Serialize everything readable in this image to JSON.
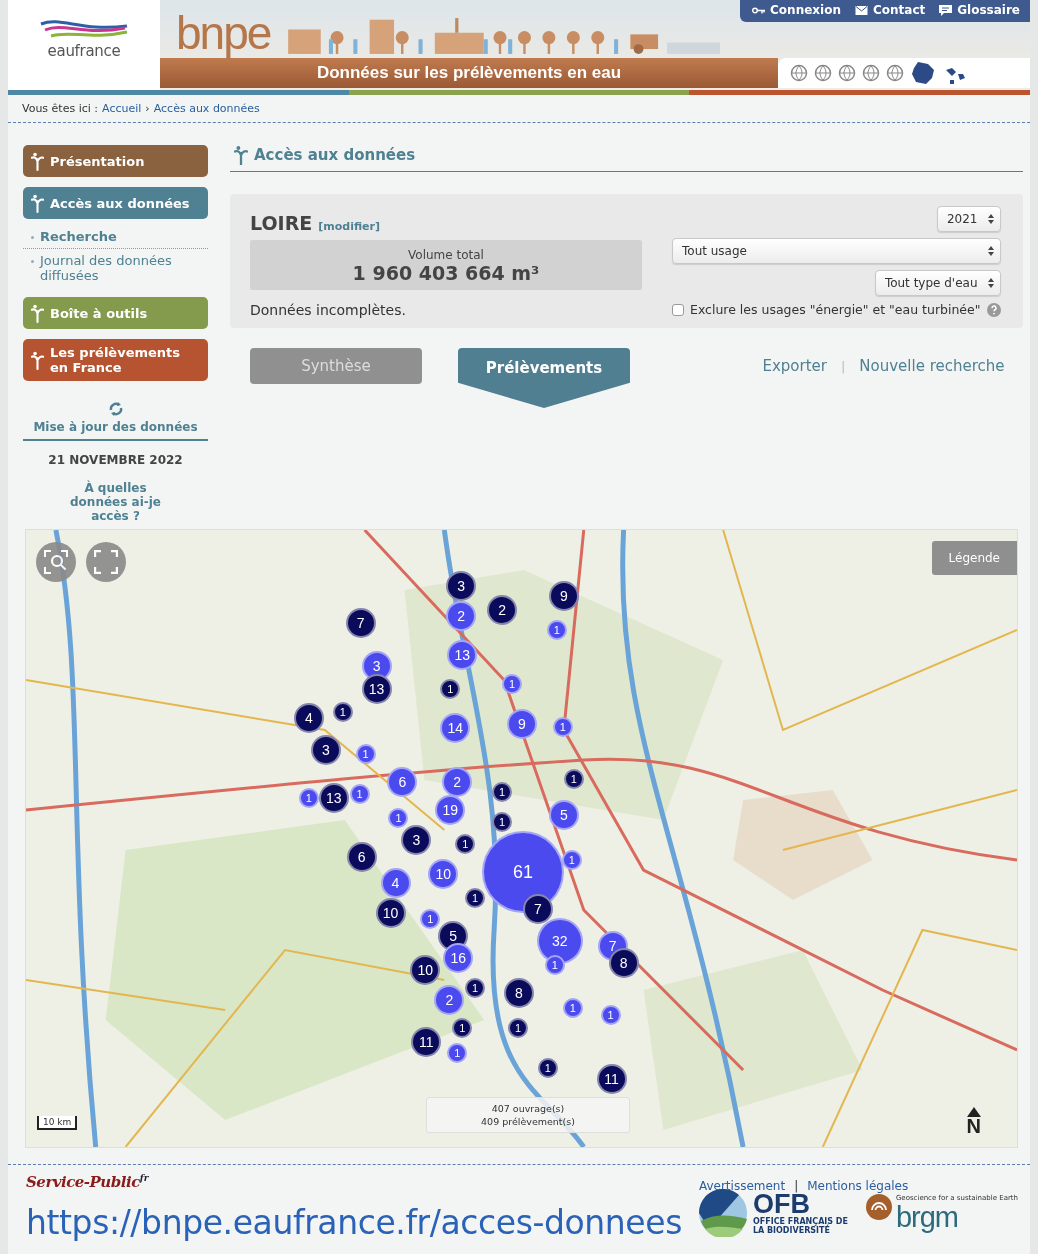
{
  "header": {
    "logo_text": "eaufrance",
    "brand": "bnpe",
    "subtitle": "Données sur les prélèvements en eau",
    "nav": [
      {
        "label": "Connexion"
      },
      {
        "label": "Contact"
      },
      {
        "label": "Glossaire"
      }
    ]
  },
  "breadcrumb": {
    "prefix": "Vous êtes ici :",
    "separator": "›",
    "items": [
      "Accueil",
      "Accès aux données"
    ]
  },
  "sidebar": {
    "sections": [
      {
        "label": "Présentation",
        "color": "#8b6240"
      },
      {
        "label": "Accès aux données",
        "color": "#4f8192",
        "children": [
          {
            "label": "Recherche",
            "selected": true
          },
          {
            "label": "Journal des données diffusées",
            "selected": false
          }
        ]
      },
      {
        "label": "Boîte à outils",
        "color": "#849a4c"
      },
      {
        "label": "Les prélèvements en France",
        "color": "#b65431"
      }
    ],
    "update_label": "Mise à jour des données",
    "update_date": "21 NOVEMBRE 2022",
    "access_link": "À quelles données ai-je accès ?"
  },
  "page_title": "Accès aux données",
  "search_panel": {
    "region": "LOIRE",
    "edit_link": "[modifier]",
    "volume_label": "Volume total",
    "volume_value": "1 960 403 664 m³",
    "note": "Données incomplètes.",
    "year": "2021",
    "usage": "Tout usage",
    "water_type": "Tout type d'eau",
    "exclude": {
      "label": "Exclure les usages \"énergie\" et \"eau turbinée\"",
      "checked": false
    }
  },
  "tabs": [
    {
      "label": "Synthèse",
      "selected": false
    },
    {
      "label": "Prélèvements",
      "selected": true
    }
  ],
  "actions": {
    "items": [
      "Exporter",
      "Nouvelle recherche"
    ],
    "separator": "|"
  },
  "map": {
    "legend_button": "Légende",
    "scale": "10 km",
    "summary": [
      "407 ouvrage(s)",
      "409 prélèvement(s)"
    ],
    "north": "N",
    "clusters": [
      {
        "count": "3",
        "color": "#0b0b5c"
      },
      {
        "count": "9",
        "color": "#0b0b5c"
      },
      {
        "count": "2",
        "color": "#4a4aee"
      },
      {
        "count": "2",
        "color": "#0b0b5c"
      },
      {
        "count": "7",
        "color": "#0b0b5c"
      },
      {
        "count": "1",
        "color": "#4a4aee"
      },
      {
        "count": "13",
        "color": "#4a4aee"
      },
      {
        "count": "3",
        "color": "#4a4aee"
      },
      {
        "count": "13",
        "color": "#0b0b5c"
      },
      {
        "count": "1",
        "color": "#0b0b5c"
      },
      {
        "count": "1",
        "color": "#4a4aee"
      },
      {
        "count": "4",
        "color": "#0b0b5c"
      },
      {
        "count": "1",
        "color": "#0b0b5c"
      },
      {
        "count": "14",
        "color": "#4a4aee"
      },
      {
        "count": "9",
        "color": "#4a4aee"
      },
      {
        "count": "1",
        "color": "#4a4aee"
      },
      {
        "count": "3",
        "color": "#0b0b5c"
      },
      {
        "count": "1",
        "color": "#4a4aee"
      },
      {
        "count": "6",
        "color": "#4a4aee"
      },
      {
        "count": "2",
        "color": "#4a4aee"
      },
      {
        "count": "1",
        "color": "#0b0b5c"
      },
      {
        "count": "1",
        "color": "#4a4aee"
      },
      {
        "count": "13",
        "color": "#0b0b5c"
      },
      {
        "count": "1",
        "color": "#4a4aee"
      },
      {
        "count": "1",
        "color": "#0b0b5c"
      },
      {
        "count": "1",
        "color": "#4a4aee"
      },
      {
        "count": "19",
        "color": "#4a4aee"
      },
      {
        "count": "1",
        "color": "#0b0b5c"
      },
      {
        "count": "5",
        "color": "#4a4aee"
      },
      {
        "count": "3",
        "color": "#0b0b5c"
      },
      {
        "count": "1",
        "color": "#0b0b5c"
      },
      {
        "count": "6",
        "color": "#0b0b5c"
      },
      {
        "count": "1",
        "color": "#4a4aee"
      },
      {
        "count": "10",
        "color": "#4a4aee"
      },
      {
        "count": "61",
        "color": "#4a4aee"
      },
      {
        "count": "4",
        "color": "#4a4aee"
      },
      {
        "count": "1",
        "color": "#0b0b5c"
      },
      {
        "count": "10",
        "color": "#0b0b5c"
      },
      {
        "count": "1",
        "color": "#4a4aee"
      },
      {
        "count": "7",
        "color": "#0b0b5c"
      },
      {
        "count": "5",
        "color": "#0b0b5c"
      },
      {
        "count": "32",
        "color": "#4a4aee"
      },
      {
        "count": "7",
        "color": "#4a4aee"
      },
      {
        "count": "10",
        "color": "#0b0b5c"
      },
      {
        "count": "16",
        "color": "#4a4aee"
      },
      {
        "count": "1",
        "color": "#4a4aee"
      },
      {
        "count": "8",
        "color": "#0b0b5c"
      },
      {
        "count": "2",
        "color": "#4a4aee"
      },
      {
        "count": "1",
        "color": "#0b0b5c"
      },
      {
        "count": "8",
        "color": "#0b0b5c"
      },
      {
        "count": "1",
        "color": "#4a4aee"
      },
      {
        "count": "1",
        "color": "#4a4aee"
      },
      {
        "count": "1",
        "color": "#0b0b5c"
      },
      {
        "count": "1",
        "color": "#0b0b5c"
      },
      {
        "count": "11",
        "color": "#0b0b5c"
      },
      {
        "count": "1",
        "color": "#4a4aee"
      },
      {
        "count": "1",
        "color": "#0b0b5c"
      },
      {
        "count": "11",
        "color": "#0b0b5c"
      }
    ]
  },
  "footer": {
    "partner_name": "Service-Public",
    "partner_suffix": "fr",
    "links": [
      "Avertissement",
      "Mentions légales"
    ],
    "separator": "|",
    "url": "https://bnpe.eaufrance.fr/acces-donnees",
    "ofb": {
      "name": "OFB",
      "subtitle": "OFFICE FRANÇAIS DE LA BIODIVERSITÉ"
    },
    "brgm": {
      "name": "brgm",
      "tagline": "Geoscience for a sustainable Earth"
    }
  }
}
